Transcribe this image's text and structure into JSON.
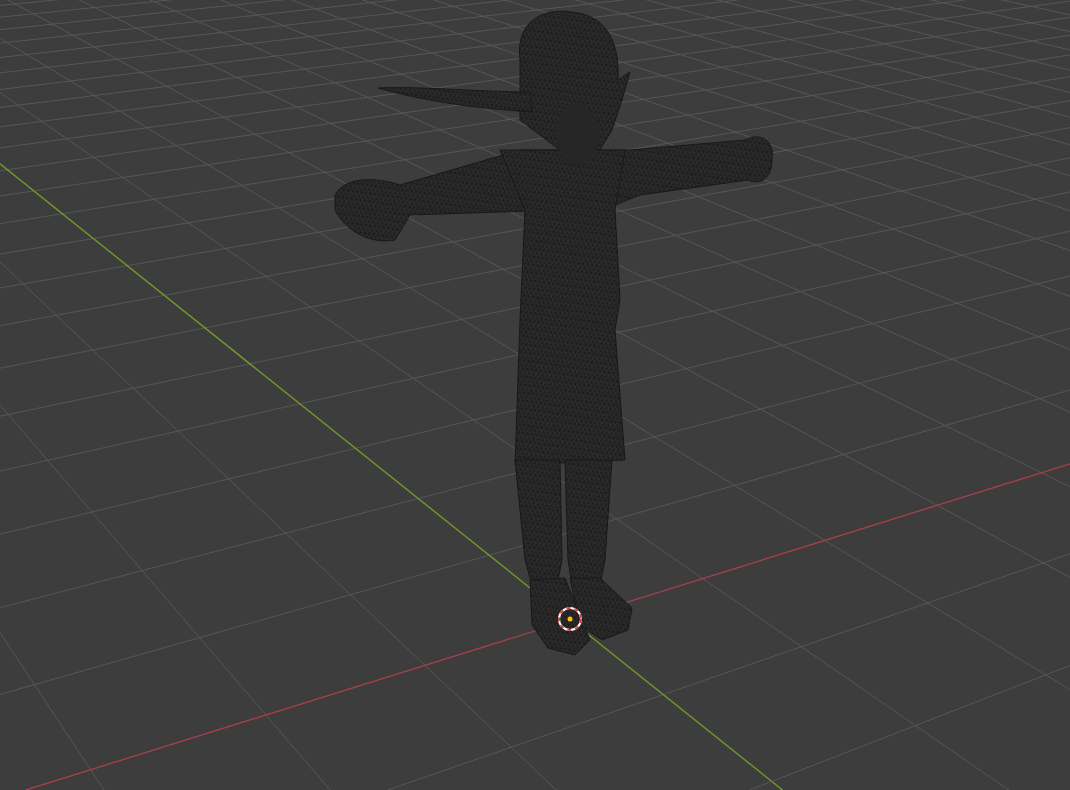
{
  "viewport": {
    "floor_grid": true,
    "axis_x": true,
    "axis_y": true,
    "cursor_3d": true,
    "mesh_object": true
  }
}
